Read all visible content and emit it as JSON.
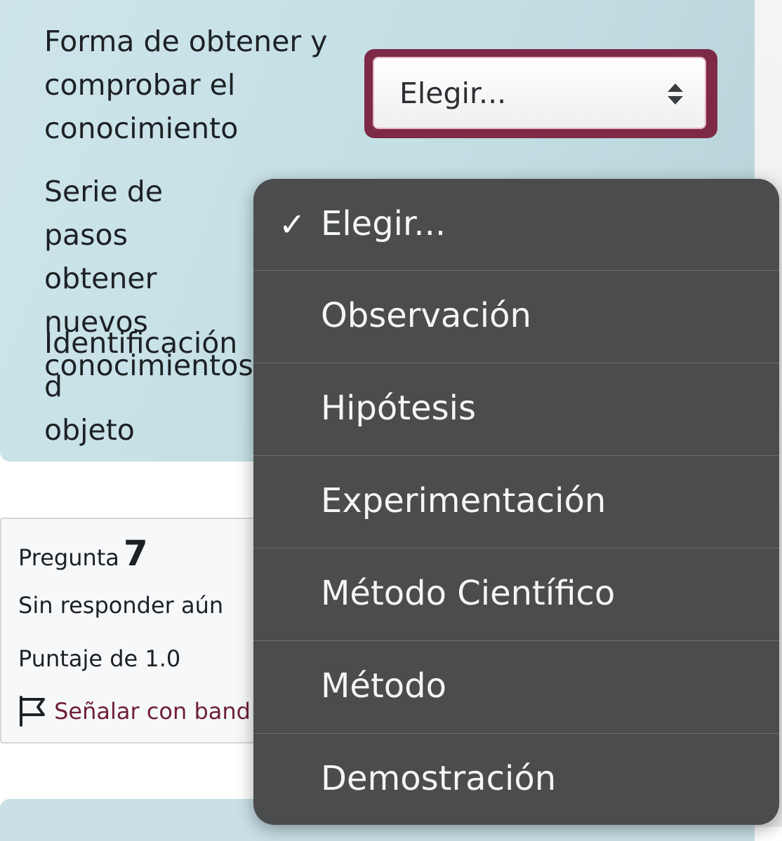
{
  "question": {
    "stems": [
      "Forma de obtener y\ncomprobar el\nconocimiento",
      "Serie de pasos\nobtener nuevos\nconocimientos.",
      "Identificación d\nobjeto"
    ],
    "select_value": "Elegir..."
  },
  "info": {
    "question_label": "Pregunta",
    "question_number": "7",
    "status": "Sin responder aún",
    "score": "Puntaje de 1.0",
    "flag_label": "Señalar con band"
  },
  "dropdown": {
    "check_glyph": "✓",
    "options": [
      "Elegir...",
      "Observación",
      "Hipótesis",
      "Experimentación",
      "Método Científico",
      "Método",
      "Demostración"
    ],
    "selected_index": 0
  }
}
